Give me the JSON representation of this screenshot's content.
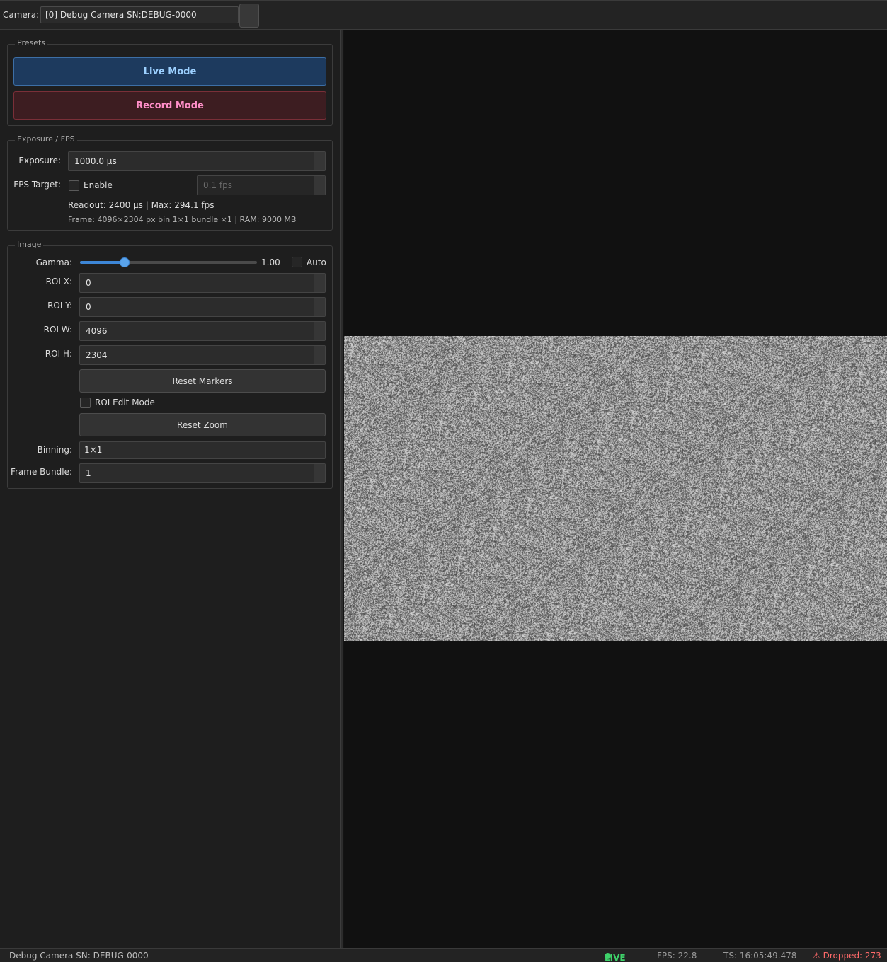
{
  "toolbar": {
    "camera_label": "Camera:",
    "camera_selected": "[0] Debug Camera  SN:DEBUG-0000"
  },
  "presets": {
    "title": "Presets",
    "live_label": "Live Mode",
    "record_label": "Record Mode"
  },
  "exposure": {
    "title": "Exposure / FPS",
    "exposure_label": "Exposure:",
    "exposure_value": "1000.0 µs",
    "fps_target_label": "FPS Target:",
    "enable_label": "Enable",
    "enable_checked": false,
    "fps_value": "0.1 fps",
    "readout_info": "Readout: 2400 µs | Max: 294.1 fps",
    "frame_info": "Frame: 4096×2304 px  bin 1×1  bundle ×1  |  RAM: 9000 MB"
  },
  "image": {
    "title": "Image",
    "gamma_label": "Gamma:",
    "gamma_value": "1.00",
    "gamma_slider_fraction": 0.25,
    "auto_label": "Auto",
    "auto_checked": false,
    "roi_x_label": "ROI  X:",
    "roi_x_value": "0",
    "roi_y_label": "ROI  Y:",
    "roi_y_value": "0",
    "roi_w_label": "ROI  W:",
    "roi_w_value": "4096",
    "roi_h_label": "ROI  H:",
    "roi_h_value": "2304",
    "reset_markers_label": "Reset Markers",
    "roi_edit_label": "ROI Edit Mode",
    "roi_edit_checked": false,
    "reset_zoom_label": "Reset Zoom",
    "binning_label": "Binning:",
    "binning_value": "1×1",
    "bundle_label": "Frame Bundle:",
    "bundle_value": "1"
  },
  "status": {
    "camera_info": "Debug Camera  SN: DEBUG-0000",
    "live_label": "LIVE",
    "fps_text": "FPS:    22.8",
    "timestamp_text": "TS: 16:05:49.478",
    "dropped_text": "⚠ Dropped: 273"
  },
  "colors": {
    "accent": "#3d86d6",
    "live_green": "#3ed26a",
    "dropped_red": "#ff6a6a",
    "live_button_text": "#9cd0ff",
    "record_button_text": "#ff8fc8"
  },
  "icons": {
    "live_indicator": "green-dot-icon",
    "dropped_warning": "warning-triangle-icon"
  }
}
